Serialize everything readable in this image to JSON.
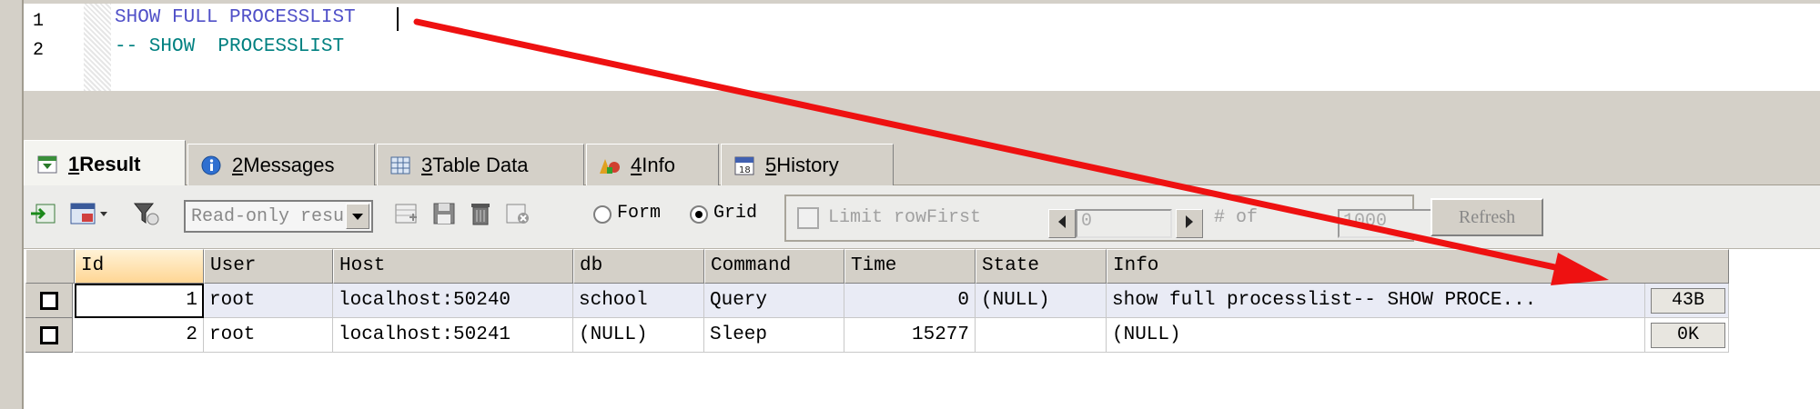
{
  "editor": {
    "lines": [
      {
        "num": "1",
        "text": "SHOW FULL PROCESSLIST",
        "color": "#5050c8"
      },
      {
        "num": "2",
        "text": "-- SHOW  PROCESSLIST",
        "color": "#008080"
      }
    ]
  },
  "tabs": [
    {
      "num": "1",
      "label": " Result",
      "icon": "result-icon",
      "active": true
    },
    {
      "num": "2",
      "label": " Messages",
      "icon": "info-circle-icon"
    },
    {
      "num": "3",
      "label": " Table Data",
      "icon": "table-icon"
    },
    {
      "num": "4",
      "label": " Info",
      "icon": "chart-icon"
    },
    {
      "num": "5",
      "label": " History",
      "icon": "calendar-icon",
      "icon_text": "18"
    }
  ],
  "toolbar": {
    "mode_select": "Read-only result",
    "form_label": "Form",
    "grid_label": "Grid",
    "limit_label": "Limit rowFirst",
    "first_row_value": "0",
    "rows_label": "# of",
    "rows_value": "1000",
    "refresh_label": "Refresh"
  },
  "grid": {
    "columns": [
      "Id",
      "User",
      "Host",
      "db",
      "Command",
      "Time",
      "State",
      "Info"
    ],
    "rows": [
      {
        "id": "1",
        "user": "root",
        "host": "localhost:50240",
        "db": "school",
        "command": "Query",
        "time": "0",
        "state": "(NULL)",
        "info": "show full processlist-- SHOW  PROCE...",
        "blob": "43B"
      },
      {
        "id": "2",
        "user": "root",
        "host": "localhost:50241",
        "db": "(NULL)",
        "command": "Sleep",
        "time": "15277",
        "state": "",
        "info": "(NULL)",
        "blob": "0K"
      }
    ]
  },
  "colors": {
    "arrow": "#ee1111",
    "selected_header": "#ffd694"
  }
}
